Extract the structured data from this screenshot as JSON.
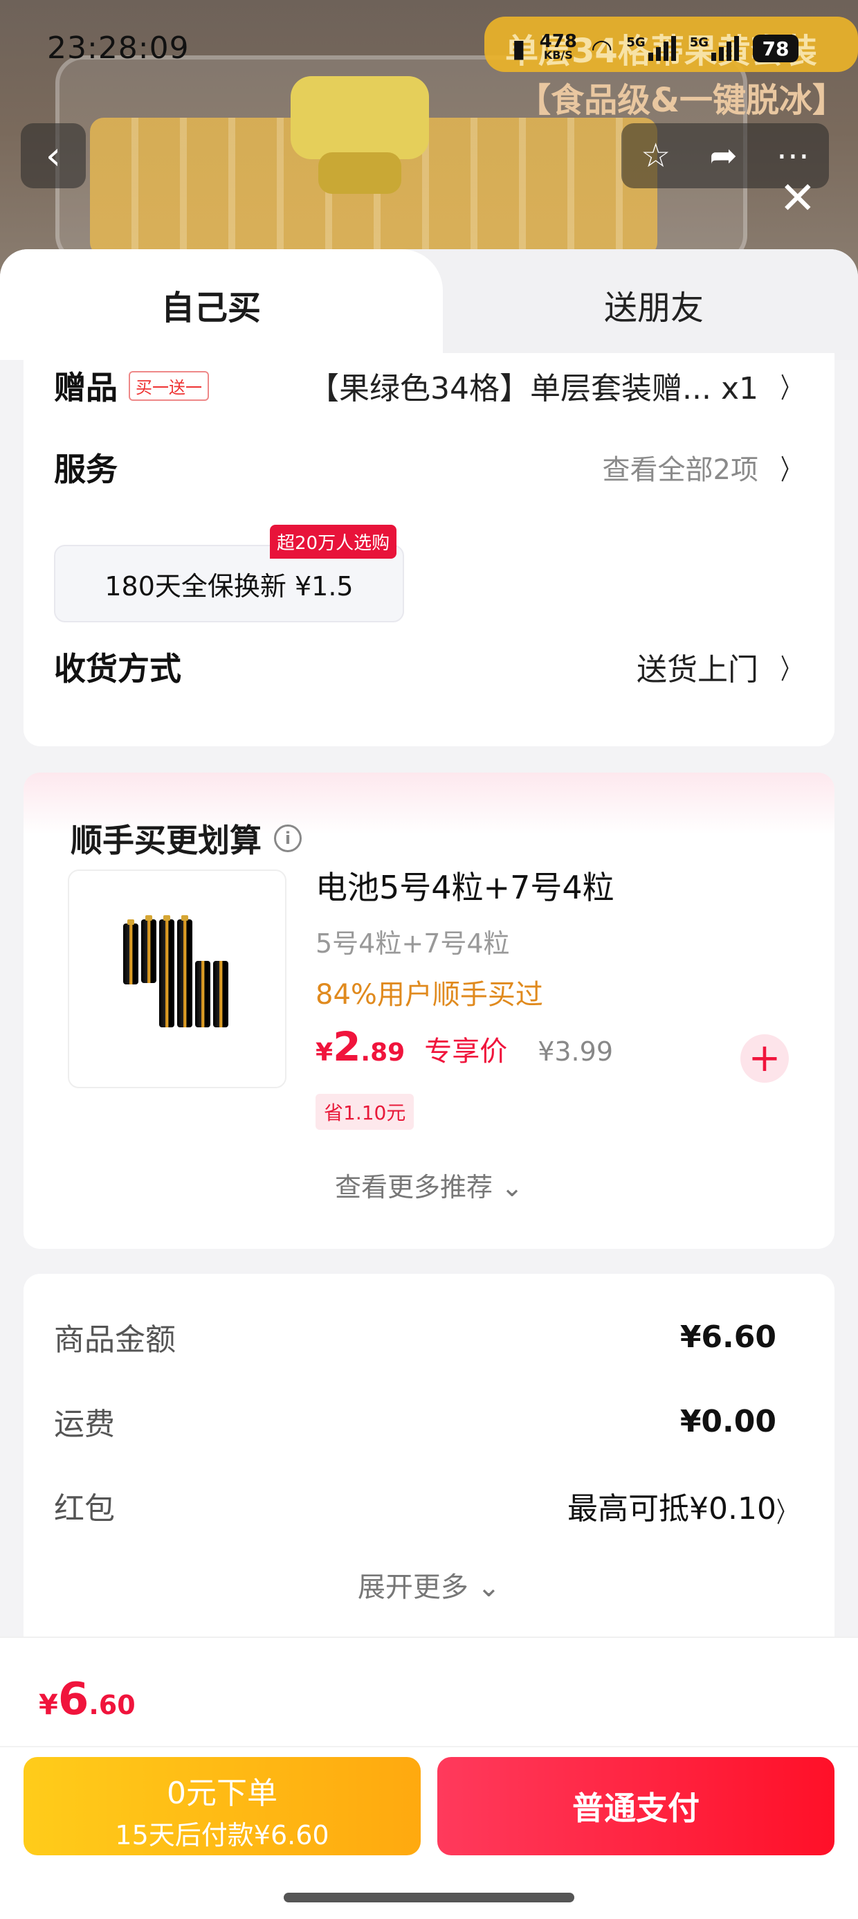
{
  "status_bar": {
    "time": "23:28:09",
    "net_speed": "478",
    "net_unit": "KB/S",
    "sig1": "5G",
    "sig2": "5G",
    "battery": "78"
  },
  "backdrop": {
    "banner_line1": "单层34格蒂果黄套装",
    "banner_line2": "【食品级&一键脱冰】"
  },
  "tabs": {
    "self": "自己买",
    "friend": "送朋友"
  },
  "order": {
    "gift_label": "赠品",
    "gift_tag": "买一送一",
    "gift_value": "【果绿色34格】单层套装赠... x1",
    "service_label": "服务",
    "service_value": "查看全部2项",
    "service_option": "180天全保换新  ¥1.5",
    "service_badge": "超20万人选购",
    "delivery_label": "收货方式",
    "delivery_value": "送货上门"
  },
  "addon": {
    "title": "顺手买更划算",
    "product_name": "电池5号4粒+7号4粒",
    "product_spec": "5号4粒+7号4粒",
    "hot_text": "84%用户顺手买过",
    "price_currency": "¥",
    "price_int": "2",
    "price_dec": ".89",
    "price_tag": "专享价",
    "orig_price": "¥3.99",
    "save_text": "省1.10元",
    "more": "查看更多推荐 ⌄"
  },
  "summary": {
    "goods_label": "商品金额",
    "goods_value": "¥6.60",
    "shipping_label": "运费",
    "shipping_value": "¥0.00",
    "redpack_label": "红包",
    "redpack_value": "最高可抵¥0.10",
    "expand": "展开更多 ⌄"
  },
  "bottom": {
    "total_currency": "¥",
    "total_int": "6",
    "total_dec": ".60",
    "later_line1": "0元下单",
    "later_line2": "15天后付款¥6.60",
    "pay_label": "普通支付"
  },
  "colors": {
    "accent_red": "#f0143c",
    "accent_orange": "#ffb414",
    "hot_orange": "#e08a1e"
  }
}
